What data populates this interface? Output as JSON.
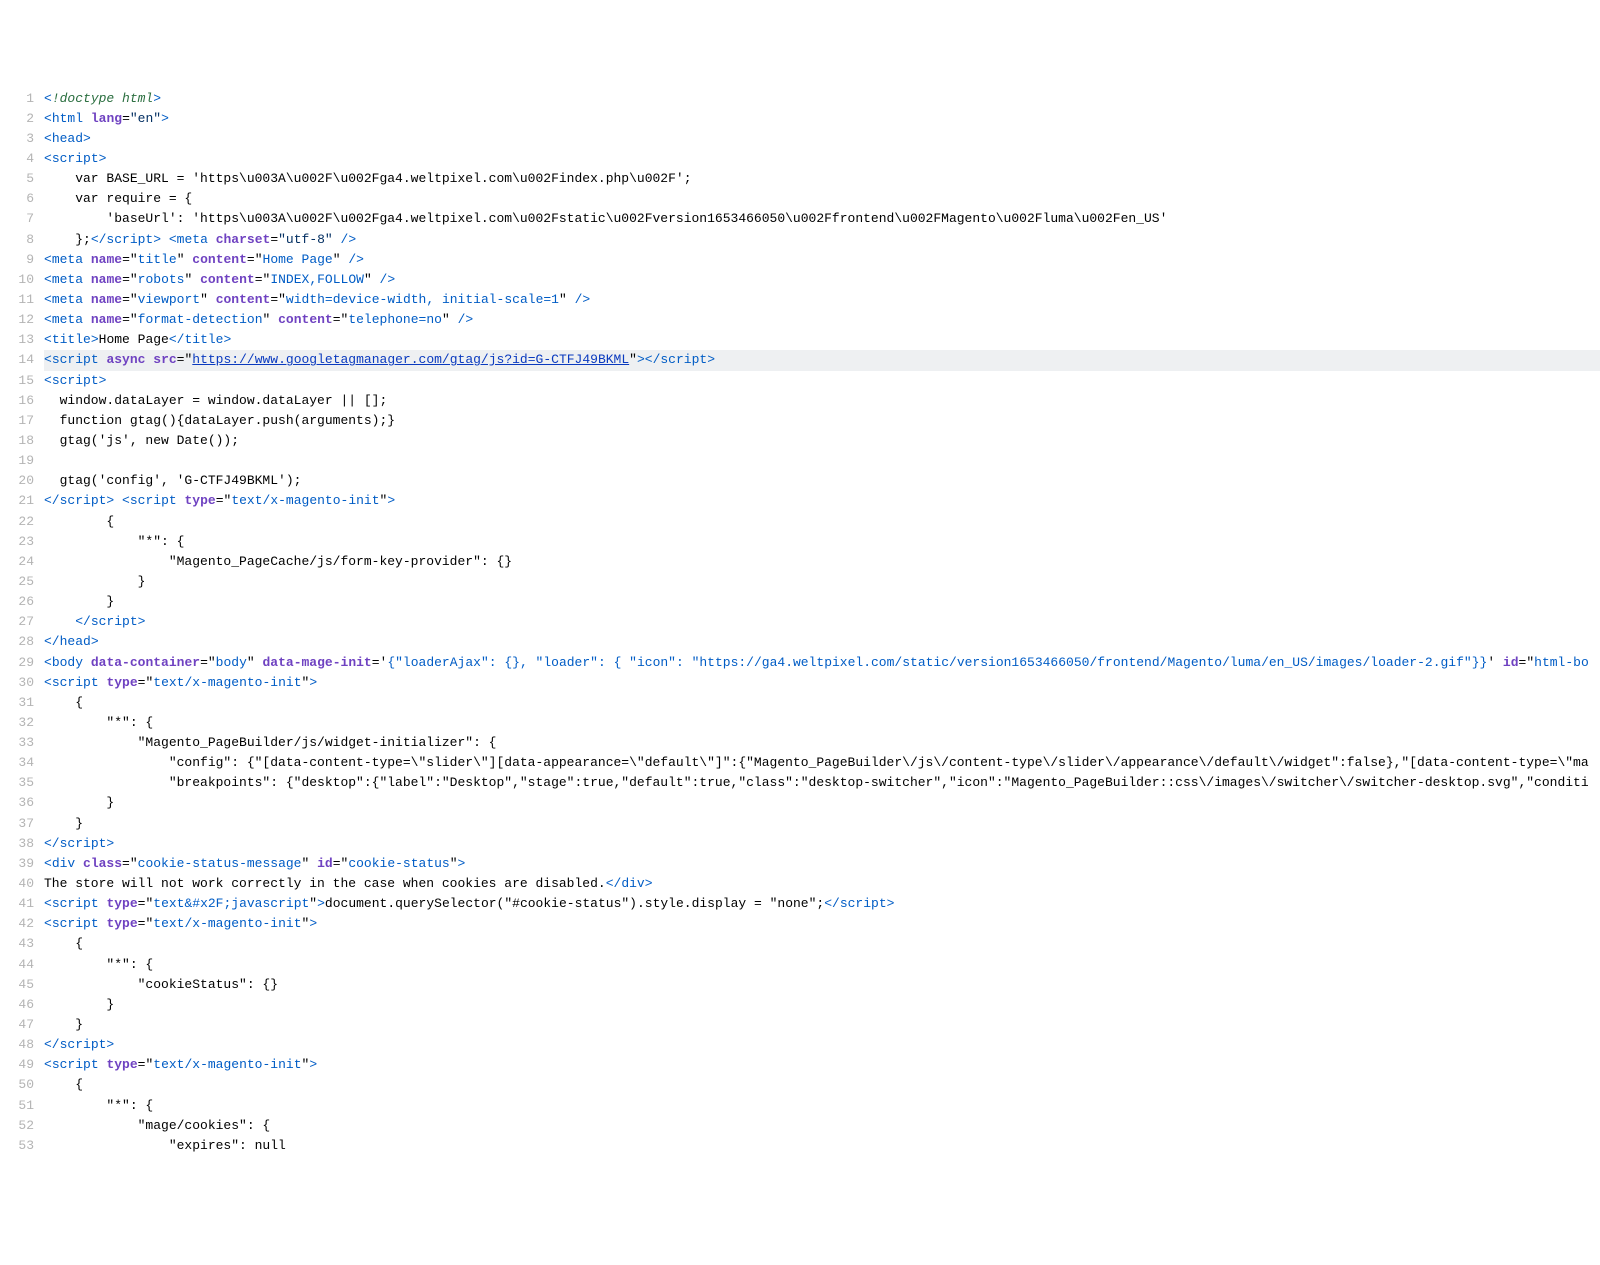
{
  "lines": [
    {
      "n": 1,
      "tokens": [
        [
          "c-punct",
          "<"
        ],
        [
          "c-doctype",
          "!doctype html"
        ],
        [
          "c-punct",
          ">"
        ]
      ]
    },
    {
      "n": 2,
      "tokens": [
        [
          "c-punct",
          "<"
        ],
        [
          "c-tag",
          "html"
        ],
        [
          "c-plain",
          " "
        ],
        [
          "c-attr",
          "lang"
        ],
        [
          "c-plain",
          "="
        ],
        [
          "c-str",
          "\"en\""
        ],
        [
          "c-punct",
          ">"
        ]
      ]
    },
    {
      "n": 3,
      "tokens": [
        [
          "c-punct",
          "<"
        ],
        [
          "c-tag",
          "head"
        ],
        [
          "c-punct",
          ">"
        ]
      ]
    },
    {
      "n": 4,
      "tokens": [
        [
          "c-punct",
          "<"
        ],
        [
          "c-tag",
          "script"
        ],
        [
          "c-punct",
          ">"
        ]
      ]
    },
    {
      "n": 5,
      "tokens": [
        [
          "c-plain",
          "    var BASE_URL = 'https\\u003A\\u002F\\u002Fga4.weltpixel.com\\u002Findex.php\\u002F';"
        ]
      ]
    },
    {
      "n": 6,
      "tokens": [
        [
          "c-plain",
          "    var require = {"
        ]
      ]
    },
    {
      "n": 7,
      "tokens": [
        [
          "c-plain",
          "        'baseUrl': 'https\\u003A\\u002F\\u002Fga4.weltpixel.com\\u002Fstatic\\u002Fversion1653466050\\u002Ffrontend\\u002FMagento\\u002Fluma\\u002Fen_US'"
        ]
      ]
    },
    {
      "n": 8,
      "tokens": [
        [
          "c-plain",
          "    };"
        ],
        [
          "c-punct",
          "</"
        ],
        [
          "c-tag",
          "script"
        ],
        [
          "c-punct",
          ">"
        ],
        [
          "c-plain",
          " "
        ],
        [
          "c-punct",
          "<"
        ],
        [
          "c-tag",
          "meta"
        ],
        [
          "c-plain",
          " "
        ],
        [
          "c-attr",
          "charset"
        ],
        [
          "c-plain",
          "="
        ],
        [
          "c-str",
          "\"utf-8\""
        ],
        [
          "c-plain",
          " "
        ],
        [
          "c-punct",
          "/>"
        ]
      ]
    },
    {
      "n": 9,
      "tokens": [
        [
          "c-punct",
          "<"
        ],
        [
          "c-tag",
          "meta"
        ],
        [
          "c-plain",
          " "
        ],
        [
          "c-attr",
          "name"
        ],
        [
          "c-plain",
          "=\""
        ],
        [
          "c-val-blue",
          "title"
        ],
        [
          "c-plain",
          "\" "
        ],
        [
          "c-attr",
          "content"
        ],
        [
          "c-plain",
          "=\""
        ],
        [
          "c-val-blue",
          "Home Page"
        ],
        [
          "c-plain",
          "\" "
        ],
        [
          "c-punct",
          "/>"
        ]
      ]
    },
    {
      "n": 10,
      "tokens": [
        [
          "c-punct",
          "<"
        ],
        [
          "c-tag",
          "meta"
        ],
        [
          "c-plain",
          " "
        ],
        [
          "c-attr",
          "name"
        ],
        [
          "c-plain",
          "=\""
        ],
        [
          "c-val-blue",
          "robots"
        ],
        [
          "c-plain",
          "\" "
        ],
        [
          "c-attr",
          "content"
        ],
        [
          "c-plain",
          "=\""
        ],
        [
          "c-val-blue",
          "INDEX,FOLLOW"
        ],
        [
          "c-plain",
          "\" "
        ],
        [
          "c-punct",
          "/>"
        ]
      ]
    },
    {
      "n": 11,
      "tokens": [
        [
          "c-punct",
          "<"
        ],
        [
          "c-tag",
          "meta"
        ],
        [
          "c-plain",
          " "
        ],
        [
          "c-attr",
          "name"
        ],
        [
          "c-plain",
          "=\""
        ],
        [
          "c-val-blue",
          "viewport"
        ],
        [
          "c-plain",
          "\" "
        ],
        [
          "c-attr",
          "content"
        ],
        [
          "c-plain",
          "=\""
        ],
        [
          "c-val-blue",
          "width=device-width, initial-scale=1"
        ],
        [
          "c-plain",
          "\" "
        ],
        [
          "c-punct",
          "/>"
        ]
      ]
    },
    {
      "n": 12,
      "tokens": [
        [
          "c-punct",
          "<"
        ],
        [
          "c-tag",
          "meta"
        ],
        [
          "c-plain",
          " "
        ],
        [
          "c-attr",
          "name"
        ],
        [
          "c-plain",
          "=\""
        ],
        [
          "c-val-blue",
          "format-detection"
        ],
        [
          "c-plain",
          "\" "
        ],
        [
          "c-attr",
          "content"
        ],
        [
          "c-plain",
          "=\""
        ],
        [
          "c-val-blue",
          "telephone=no"
        ],
        [
          "c-plain",
          "\" "
        ],
        [
          "c-punct",
          "/>"
        ]
      ]
    },
    {
      "n": 13,
      "tokens": [
        [
          "c-punct",
          "<"
        ],
        [
          "c-tag",
          "title"
        ],
        [
          "c-punct",
          ">"
        ],
        [
          "c-plain",
          "Home Page"
        ],
        [
          "c-punct",
          "</"
        ],
        [
          "c-tag",
          "title"
        ],
        [
          "c-punct",
          ">"
        ]
      ]
    },
    {
      "n": 14,
      "highlight": true,
      "tokens": [
        [
          "c-punct",
          "<"
        ],
        [
          "c-tag",
          "script"
        ],
        [
          "c-plain",
          " "
        ],
        [
          "c-attr",
          "async"
        ],
        [
          "c-plain",
          " "
        ],
        [
          "c-attr",
          "src"
        ],
        [
          "c-plain",
          "=\""
        ],
        [
          "c-link",
          "https://www.googletagmanager.com/gtag/js?id=G-CTFJ49BKML"
        ],
        [
          "c-plain",
          "\""
        ],
        [
          "c-punct",
          "></"
        ],
        [
          "c-tag",
          "script"
        ],
        [
          "c-punct",
          ">"
        ]
      ]
    },
    {
      "n": 15,
      "tokens": [
        [
          "c-punct",
          "<"
        ],
        [
          "c-tag",
          "script"
        ],
        [
          "c-punct",
          ">"
        ]
      ]
    },
    {
      "n": 16,
      "tokens": [
        [
          "c-plain",
          "  window.dataLayer = window.dataLayer || [];"
        ]
      ]
    },
    {
      "n": 17,
      "tokens": [
        [
          "c-plain",
          "  function gtag(){dataLayer.push(arguments);}"
        ]
      ]
    },
    {
      "n": 18,
      "tokens": [
        [
          "c-plain",
          "  gtag('js', new Date());"
        ]
      ]
    },
    {
      "n": 19,
      "tokens": [
        [
          "c-plain",
          ""
        ]
      ]
    },
    {
      "n": 20,
      "tokens": [
        [
          "c-plain",
          "  gtag('config', 'G-CTFJ49BKML');"
        ]
      ]
    },
    {
      "n": 21,
      "tokens": [
        [
          "c-punct",
          "</"
        ],
        [
          "c-tag",
          "script"
        ],
        [
          "c-punct",
          ">"
        ],
        [
          "c-plain",
          " "
        ],
        [
          "c-punct",
          "<"
        ],
        [
          "c-tag",
          "script"
        ],
        [
          "c-plain",
          " "
        ],
        [
          "c-attr",
          "type"
        ],
        [
          "c-plain",
          "=\""
        ],
        [
          "c-val-blue",
          "text/x-magento-init"
        ],
        [
          "c-plain",
          "\""
        ],
        [
          "c-punct",
          ">"
        ]
      ]
    },
    {
      "n": 22,
      "tokens": [
        [
          "c-plain",
          "        {"
        ]
      ]
    },
    {
      "n": 23,
      "tokens": [
        [
          "c-plain",
          "            \"*\": {"
        ]
      ]
    },
    {
      "n": 24,
      "tokens": [
        [
          "c-plain",
          "                \"Magento_PageCache/js/form-key-provider\": {}"
        ]
      ]
    },
    {
      "n": 25,
      "tokens": [
        [
          "c-plain",
          "            }"
        ]
      ]
    },
    {
      "n": 26,
      "tokens": [
        [
          "c-plain",
          "        }"
        ]
      ]
    },
    {
      "n": 27,
      "tokens": [
        [
          "c-plain",
          "    "
        ],
        [
          "c-punct",
          "</"
        ],
        [
          "c-tag",
          "script"
        ],
        [
          "c-punct",
          ">"
        ]
      ]
    },
    {
      "n": 28,
      "tokens": [
        [
          "c-punct",
          "</"
        ],
        [
          "c-tag",
          "head"
        ],
        [
          "c-punct",
          ">"
        ]
      ]
    },
    {
      "n": 29,
      "tokens": [
        [
          "c-punct",
          "<"
        ],
        [
          "c-tag",
          "body"
        ],
        [
          "c-plain",
          " "
        ],
        [
          "c-attr",
          "data-container"
        ],
        [
          "c-plain",
          "=\""
        ],
        [
          "c-val-blue",
          "body"
        ],
        [
          "c-plain",
          "\" "
        ],
        [
          "c-attr",
          "data-mage-init"
        ],
        [
          "c-plain",
          "='"
        ],
        [
          "c-val-blue",
          "{\"loaderAjax\": {}, \"loader\": { \"icon\": \"https://ga4.weltpixel.com/static/version1653466050/frontend/Magento/luma/en_US/images/loader-2.gif\"}}"
        ],
        [
          "c-plain",
          "' "
        ],
        [
          "c-attr",
          "id"
        ],
        [
          "c-plain",
          "=\""
        ],
        [
          "c-val-blue",
          "html-bo"
        ]
      ]
    },
    {
      "n": 30,
      "tokens": [
        [
          "c-punct",
          "<"
        ],
        [
          "c-tag",
          "script"
        ],
        [
          "c-plain",
          " "
        ],
        [
          "c-attr",
          "type"
        ],
        [
          "c-plain",
          "=\""
        ],
        [
          "c-val-blue",
          "text/x-magento-init"
        ],
        [
          "c-plain",
          "\""
        ],
        [
          "c-punct",
          ">"
        ]
      ]
    },
    {
      "n": 31,
      "tokens": [
        [
          "c-plain",
          "    {"
        ]
      ]
    },
    {
      "n": 32,
      "tokens": [
        [
          "c-plain",
          "        \"*\": {"
        ]
      ]
    },
    {
      "n": 33,
      "tokens": [
        [
          "c-plain",
          "            \"Magento_PageBuilder/js/widget-initializer\": {"
        ]
      ]
    },
    {
      "n": 34,
      "tokens": [
        [
          "c-plain",
          "                \"config\": {\"[data-content-type=\\\"slider\\\"][data-appearance=\\\"default\\\"]\":{\"Magento_PageBuilder\\/js\\/content-type\\/slider\\/appearance\\/default\\/widget\":false},\"[data-content-type=\\\"ma"
        ]
      ]
    },
    {
      "n": 35,
      "tokens": [
        [
          "c-plain",
          "                \"breakpoints\": {\"desktop\":{\"label\":\"Desktop\",\"stage\":true,\"default\":true,\"class\":\"desktop-switcher\",\"icon\":\"Magento_PageBuilder::css\\/images\\/switcher\\/switcher-desktop.svg\",\"conditi"
        ]
      ]
    },
    {
      "n": 36,
      "tokens": [
        [
          "c-plain",
          "        }"
        ]
      ]
    },
    {
      "n": 37,
      "tokens": [
        [
          "c-plain",
          "    }"
        ]
      ]
    },
    {
      "n": 38,
      "tokens": [
        [
          "c-punct",
          "</"
        ],
        [
          "c-tag",
          "script"
        ],
        [
          "c-punct",
          ">"
        ]
      ]
    },
    {
      "n": 39,
      "tokens": [
        [
          "c-punct",
          "<"
        ],
        [
          "c-tag",
          "div"
        ],
        [
          "c-plain",
          " "
        ],
        [
          "c-attr",
          "class"
        ],
        [
          "c-plain",
          "=\""
        ],
        [
          "c-val-blue",
          "cookie-status-message"
        ],
        [
          "c-plain",
          "\" "
        ],
        [
          "c-attr",
          "id"
        ],
        [
          "c-plain",
          "=\""
        ],
        [
          "c-val-blue",
          "cookie-status"
        ],
        [
          "c-plain",
          "\""
        ],
        [
          "c-punct",
          ">"
        ]
      ]
    },
    {
      "n": 40,
      "tokens": [
        [
          "c-plain",
          "The store will not work correctly in the case when cookies are disabled."
        ],
        [
          "c-punct",
          "</"
        ],
        [
          "c-tag",
          "div"
        ],
        [
          "c-punct",
          ">"
        ]
      ]
    },
    {
      "n": 41,
      "tokens": [
        [
          "c-punct",
          "<"
        ],
        [
          "c-tag",
          "script"
        ],
        [
          "c-plain",
          " "
        ],
        [
          "c-attr",
          "type"
        ],
        [
          "c-plain",
          "=\""
        ],
        [
          "c-val-blue",
          "text&#x2F;javascript"
        ],
        [
          "c-plain",
          "\""
        ],
        [
          "c-punct",
          ">"
        ],
        [
          "c-plain",
          "document.querySelector(\"#cookie-status\").style.display = \"none\";"
        ],
        [
          "c-punct",
          "</"
        ],
        [
          "c-tag",
          "script"
        ],
        [
          "c-punct",
          ">"
        ]
      ]
    },
    {
      "n": 42,
      "tokens": [
        [
          "c-punct",
          "<"
        ],
        [
          "c-tag",
          "script"
        ],
        [
          "c-plain",
          " "
        ],
        [
          "c-attr",
          "type"
        ],
        [
          "c-plain",
          "=\""
        ],
        [
          "c-val-blue",
          "text/x-magento-init"
        ],
        [
          "c-plain",
          "\""
        ],
        [
          "c-punct",
          ">"
        ]
      ]
    },
    {
      "n": 43,
      "tokens": [
        [
          "c-plain",
          "    {"
        ]
      ]
    },
    {
      "n": 44,
      "tokens": [
        [
          "c-plain",
          "        \"*\": {"
        ]
      ]
    },
    {
      "n": 45,
      "tokens": [
        [
          "c-plain",
          "            \"cookieStatus\": {}"
        ]
      ]
    },
    {
      "n": 46,
      "tokens": [
        [
          "c-plain",
          "        }"
        ]
      ]
    },
    {
      "n": 47,
      "tokens": [
        [
          "c-plain",
          "    }"
        ]
      ]
    },
    {
      "n": 48,
      "tokens": [
        [
          "c-punct",
          "</"
        ],
        [
          "c-tag",
          "script"
        ],
        [
          "c-punct",
          ">"
        ]
      ]
    },
    {
      "n": 49,
      "tokens": [
        [
          "c-punct",
          "<"
        ],
        [
          "c-tag",
          "script"
        ],
        [
          "c-plain",
          " "
        ],
        [
          "c-attr",
          "type"
        ],
        [
          "c-plain",
          "=\""
        ],
        [
          "c-val-blue",
          "text/x-magento-init"
        ],
        [
          "c-plain",
          "\""
        ],
        [
          "c-punct",
          ">"
        ]
      ]
    },
    {
      "n": 50,
      "tokens": [
        [
          "c-plain",
          "    {"
        ]
      ]
    },
    {
      "n": 51,
      "tokens": [
        [
          "c-plain",
          "        \"*\": {"
        ]
      ]
    },
    {
      "n": 52,
      "tokens": [
        [
          "c-plain",
          "            \"mage/cookies\": {"
        ]
      ]
    },
    {
      "n": 53,
      "tokens": [
        [
          "c-plain",
          "                \"expires\": null"
        ]
      ]
    }
  ]
}
